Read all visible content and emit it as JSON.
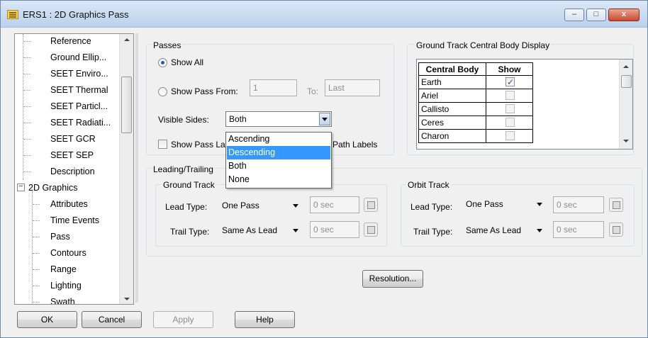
{
  "window": {
    "title": "ERS1 : 2D Graphics Pass",
    "minimize_glyph": "–",
    "maximize_glyph": "□",
    "close_glyph": "x"
  },
  "tree": {
    "items": [
      {
        "label": "Reference"
      },
      {
        "label": "Ground Ellip..."
      },
      {
        "label": "SEET Enviro..."
      },
      {
        "label": "SEET Thermal"
      },
      {
        "label": "SEET Particl..."
      },
      {
        "label": "SEET Radiati..."
      },
      {
        "label": "SEET GCR"
      },
      {
        "label": "SEET SEP"
      },
      {
        "label": "Description"
      },
      {
        "label": "2D Graphics",
        "expander": "−"
      },
      {
        "label": "Attributes"
      },
      {
        "label": "Time Events"
      },
      {
        "label": "Pass"
      },
      {
        "label": "Contours"
      },
      {
        "label": "Range"
      },
      {
        "label": "Lighting"
      },
      {
        "label": "Swath"
      }
    ]
  },
  "passes": {
    "group_label": "Passes",
    "show_all_label": "Show All",
    "show_pass_from_label": "Show Pass From:",
    "from_value": "1",
    "to_label": "To:",
    "to_value": "Last",
    "visible_sides_label": "Visible Sides:",
    "visible_sides_value": "Both",
    "show_pass_label_prefix": "Show Pass La",
    "path_labels_suffix": "Path Labels",
    "dropdown_options": [
      "Ascending",
      "Descending",
      "Both",
      "None"
    ],
    "highlighted_option": "Descending"
  },
  "leading_trailing": {
    "group_label": "Leading/Trailing",
    "ground_track": {
      "label": "Ground Track",
      "lead_type_label": "Lead Type:",
      "lead_type_value": "One Pass",
      "lead_time": "0 sec",
      "trail_type_label": "Trail Type:",
      "trail_type_value": "Same As Lead",
      "trail_time": "0 sec"
    },
    "orbit_track": {
      "label": "Orbit Track",
      "lead_type_label": "Lead Type:",
      "lead_type_value": "One Pass",
      "lead_time": "0 sec",
      "trail_type_label": "Trail Type:",
      "trail_type_value": "Same As Lead",
      "trail_time": "0 sec"
    }
  },
  "central_body": {
    "group_label": "Ground Track Central Body Display",
    "col_body": "Central Body",
    "col_show": "Show",
    "rows": [
      {
        "body": "Earth",
        "show": true
      },
      {
        "body": "Ariel",
        "show": false
      },
      {
        "body": "Callisto",
        "show": false
      },
      {
        "body": "Ceres",
        "show": false
      },
      {
        "body": "Charon",
        "show": false
      }
    ]
  },
  "buttons": {
    "resolution": "Resolution...",
    "ok": "OK",
    "cancel": "Cancel",
    "apply": "Apply",
    "help": "Help"
  }
}
